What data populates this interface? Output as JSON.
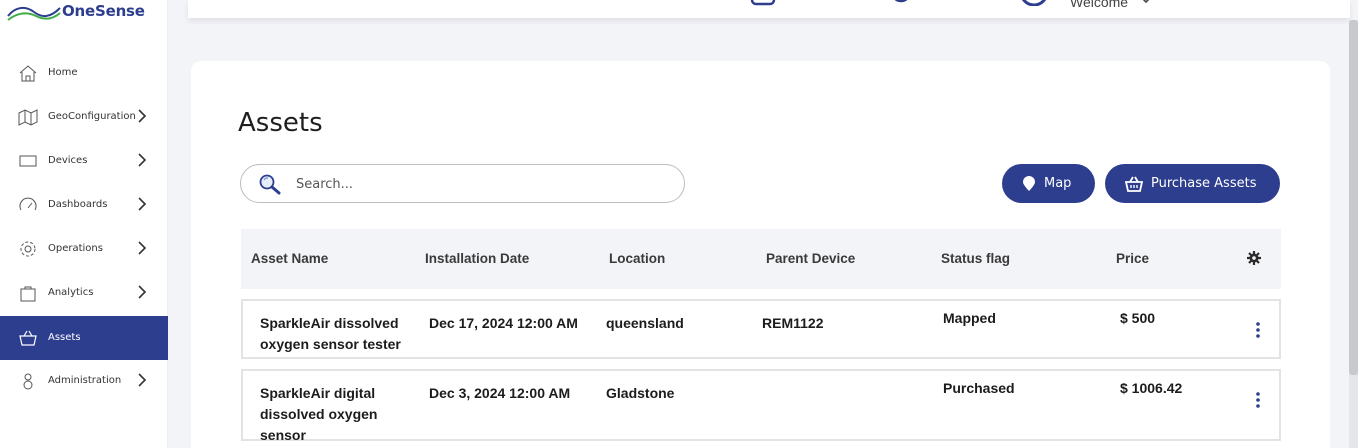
{
  "brand": {
    "name": "OneSense",
    "accent": "#2d3e8f"
  },
  "topbar": {
    "welcome": "Welcome"
  },
  "sidebar": {
    "items": [
      {
        "label": "Home",
        "icon": "home-icon",
        "has_submenu": false,
        "active": false
      },
      {
        "label": "GeoConfiguration",
        "icon": "map-icon",
        "has_submenu": true,
        "active": false
      },
      {
        "label": "Devices",
        "icon": "monitor-icon",
        "has_submenu": true,
        "active": false
      },
      {
        "label": "Dashboards",
        "icon": "gauge-icon",
        "has_submenu": true,
        "active": false
      },
      {
        "label": "Operations",
        "icon": "gear-icon",
        "has_submenu": true,
        "active": false
      },
      {
        "label": "Analytics",
        "icon": "bag-icon",
        "has_submenu": true,
        "active": false
      },
      {
        "label": "Assets",
        "icon": "basket-icon",
        "has_submenu": false,
        "active": true
      },
      {
        "label": "Administration",
        "icon": "admin-icon",
        "has_submenu": true,
        "active": false
      }
    ]
  },
  "main": {
    "title": "Assets",
    "search": {
      "placeholder": "Search...",
      "value": ""
    },
    "buttons": {
      "map": "Map",
      "purchase": "Purchase Assets"
    },
    "table": {
      "columns": [
        "Asset Name",
        "Installation Date",
        "Location",
        "Parent Device",
        "Status flag",
        "Price"
      ],
      "rows": [
        {
          "name": "SparkleAir dissolved oxygen sensor tester",
          "date": "Dec 17, 2024 12:00 AM",
          "location": "queensland",
          "parent": "REM1122",
          "status": "Mapped",
          "price": "$ 500"
        },
        {
          "name": "SparkleAir digital dissolved oxygen sensor",
          "date": "Dec 3, 2024 12:00 AM",
          "location": "Gladstone",
          "parent": "",
          "status": "Purchased",
          "price": "$ 1006.42"
        }
      ]
    }
  }
}
